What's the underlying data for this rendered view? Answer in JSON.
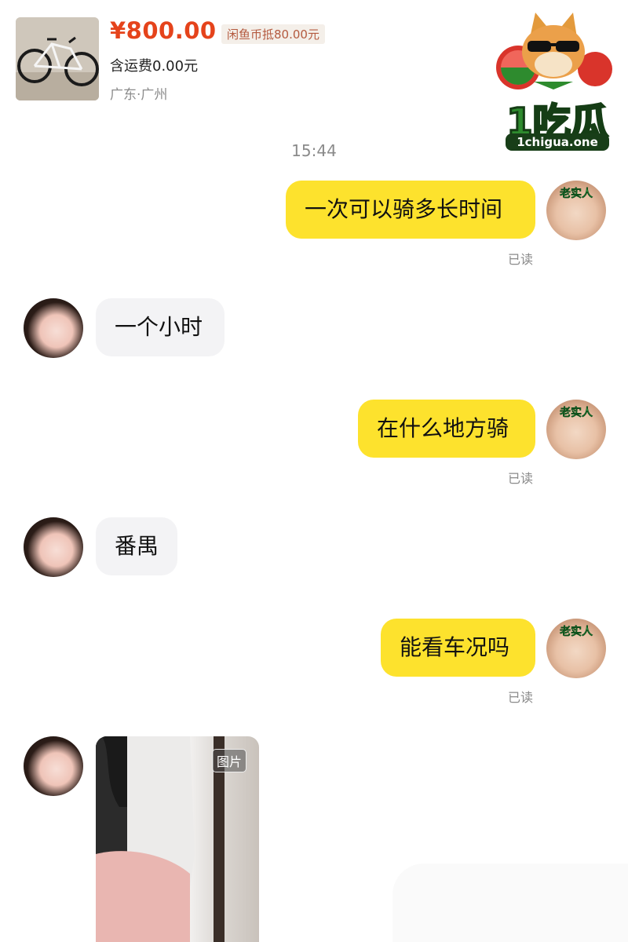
{
  "product": {
    "price": "¥800.00",
    "discount": "闲鱼币抵80.00元",
    "shipping": "含运费0.00元",
    "location": "广东·广州",
    "thumbnail_icon": "bicycle-icon"
  },
  "watermark": {
    "brand": "1吃瓜",
    "url": "1chigua.one"
  },
  "chat": {
    "timestamp": "15:44",
    "read_label": "已读",
    "my_avatar_tag": "老实人",
    "messages": [
      {
        "side": "out",
        "text": "一次可以骑多长时间"
      },
      {
        "side": "in",
        "text": "一个小时"
      },
      {
        "side": "out",
        "text": "在什么地方骑"
      },
      {
        "side": "in",
        "text": "番禺"
      },
      {
        "side": "out",
        "text": "能看车况吗"
      }
    ],
    "image_message": {
      "tag": "图片"
    }
  },
  "colors": {
    "outgoing_bubble": "#fde22d",
    "incoming_bubble": "#f3f3f5",
    "price": "#e5431b"
  }
}
